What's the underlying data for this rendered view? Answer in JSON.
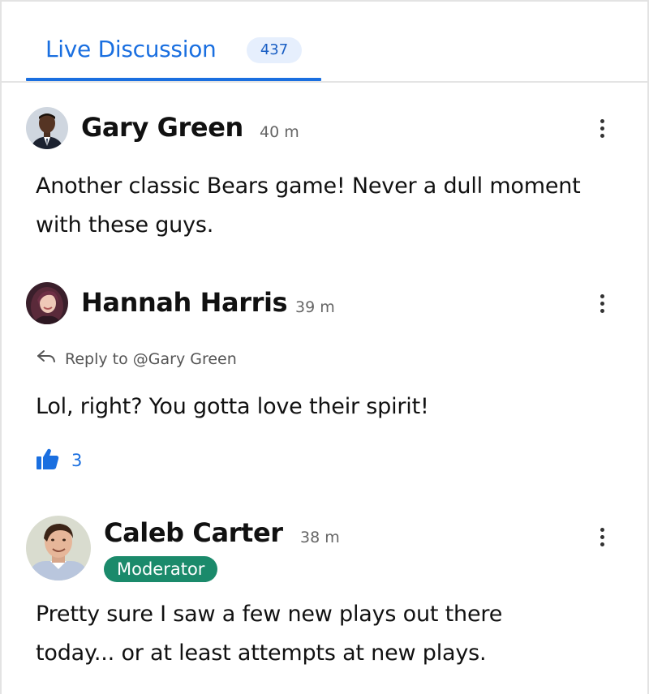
{
  "tabs": {
    "label": "Live Discussion",
    "count": "437",
    "active_color": "#1a6fe0"
  },
  "comments": [
    {
      "author": "Gary Green",
      "time": "40 m",
      "text": "Another classic Bears game! Never a dull moment with these guys."
    },
    {
      "author": "Hannah Harris",
      "time": "39 m",
      "reply_to": "Reply to @Gary Green",
      "text": "Lol, right? You gotta love their spirit!",
      "likes": "3"
    },
    {
      "author": "Caleb Carter",
      "time": "38 m",
      "badge": "Moderator",
      "badge_color": "#1b8a6b",
      "text": "Pretty sure I saw a few new plays out there today... or at least attempts at new plays."
    }
  ],
  "icons": {
    "more": "kebab-menu-icon",
    "reply": "reply-arrow-icon",
    "like": "thumbs-up-icon"
  }
}
